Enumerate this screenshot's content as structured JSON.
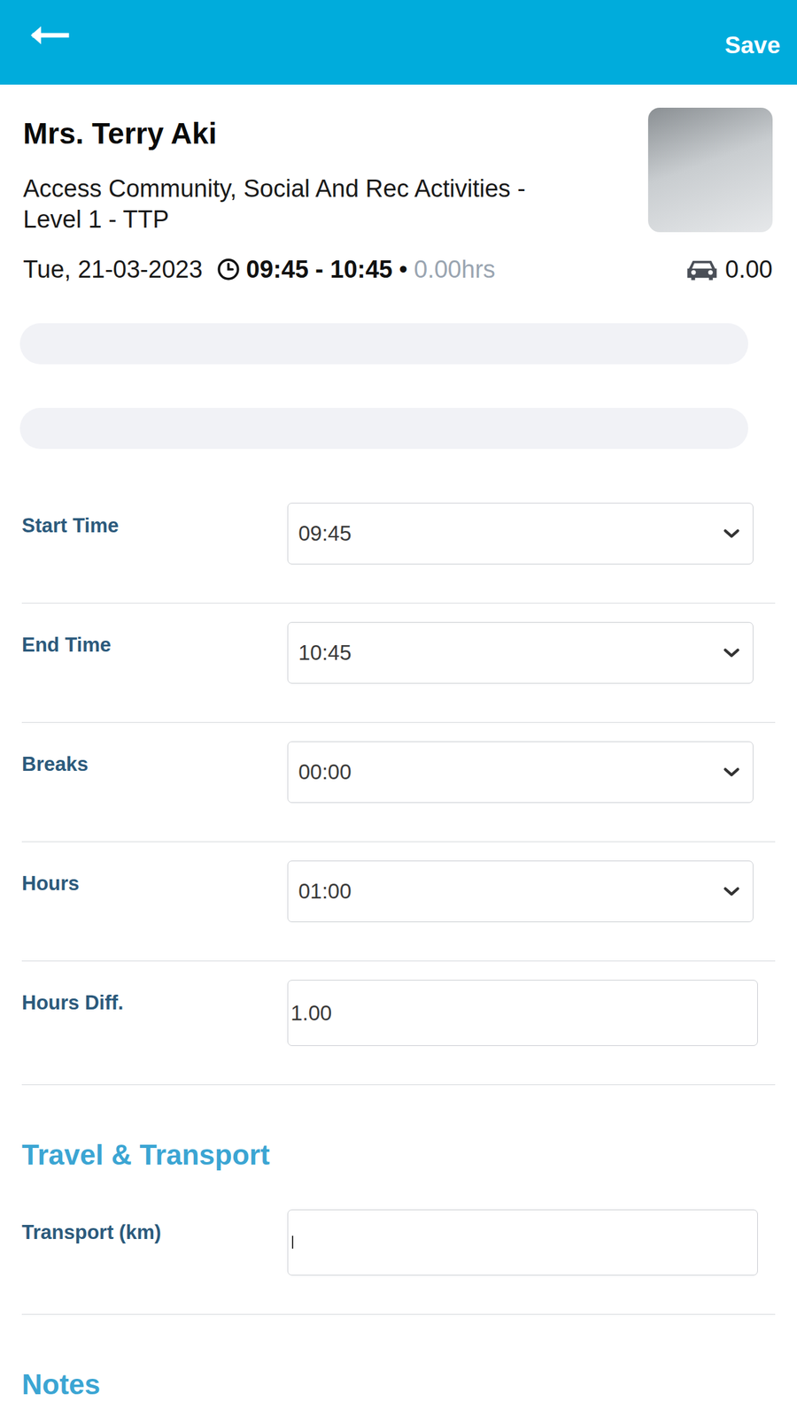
{
  "header": {
    "save": "Save"
  },
  "client": {
    "name": "Mrs. Terry Aki",
    "service": "Access Community, Social And Rec Activities - Level 1 - TTP",
    "date": "Tue, 21-03-2023",
    "time": "09:45 - 10:45",
    "separator": "•",
    "hours": "0.00hrs",
    "transport": "0.00"
  },
  "fields": [
    {
      "label": "Start Time",
      "value": "09:45",
      "kind": "select",
      "focused": false
    },
    {
      "label": "End Time",
      "value": "10:45",
      "kind": "select",
      "focused": false
    },
    {
      "label": "Breaks",
      "value": "00:00",
      "kind": "select",
      "focused": false
    },
    {
      "label": "Hours",
      "value": "01:00",
      "kind": "select",
      "focused": false
    },
    {
      "label": "Hours Diff.",
      "value": "1.00",
      "kind": "input",
      "focused": false
    }
  ],
  "sections": [
    {
      "title": "Travel & Transport",
      "fields": [
        {
          "label": "Transport (km)",
          "value": "",
          "kind": "input",
          "focused": true
        }
      ]
    },
    {
      "title": "Notes",
      "fields": []
    }
  ]
}
